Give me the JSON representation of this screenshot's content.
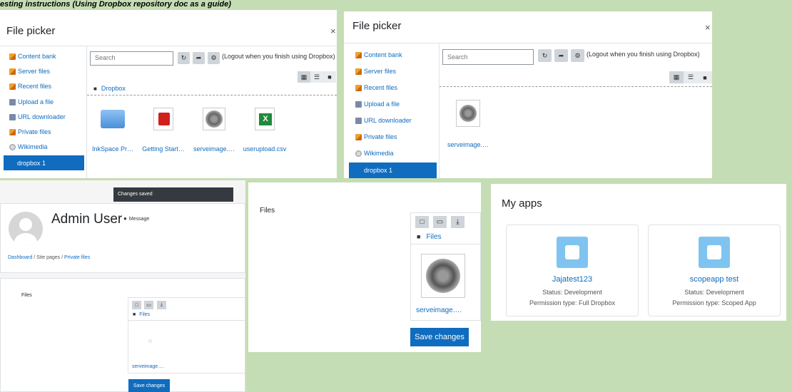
{
  "heading": "esting instructions (Using Dropbox repository doc as a guide)",
  "picker": {
    "title": "File picker",
    "close": "×",
    "repos": [
      "Content bank",
      "Server files",
      "Recent files",
      "Upload a file",
      "URL downloader",
      "Private files",
      "Wikimedia",
      "dropbox 1"
    ],
    "search_placeholder": "Search",
    "logout": "(Logout when you finish using Dropbox)",
    "crumb": "Dropbox",
    "files_left": [
      "InkSpace Pr…",
      "Getting Start…",
      "serveimage.…",
      "userupload.csv"
    ],
    "files_right": [
      "serveimage.…"
    ]
  },
  "toast": "Changes saved",
  "profile": {
    "name": "Admin User",
    "message": "Message",
    "breadcrumb": [
      "Dashboard",
      "Site pages",
      "Private files"
    ]
  },
  "files_label": "Files",
  "files_folder": "Files",
  "file_name": "serveimage.…",
  "save_changes": "Save changes",
  "apps": {
    "title": "My apps",
    "items": [
      {
        "name": "Jajatest123",
        "status": "Status: Development",
        "permission": "Permission type: Full Dropbox"
      },
      {
        "name": "scopeapp test",
        "status": "Status: Development",
        "permission": "Permission type: Scoped App"
      }
    ]
  },
  "colors": {
    "accent": "#0f6cbf",
    "background": "#c5ddb4"
  }
}
